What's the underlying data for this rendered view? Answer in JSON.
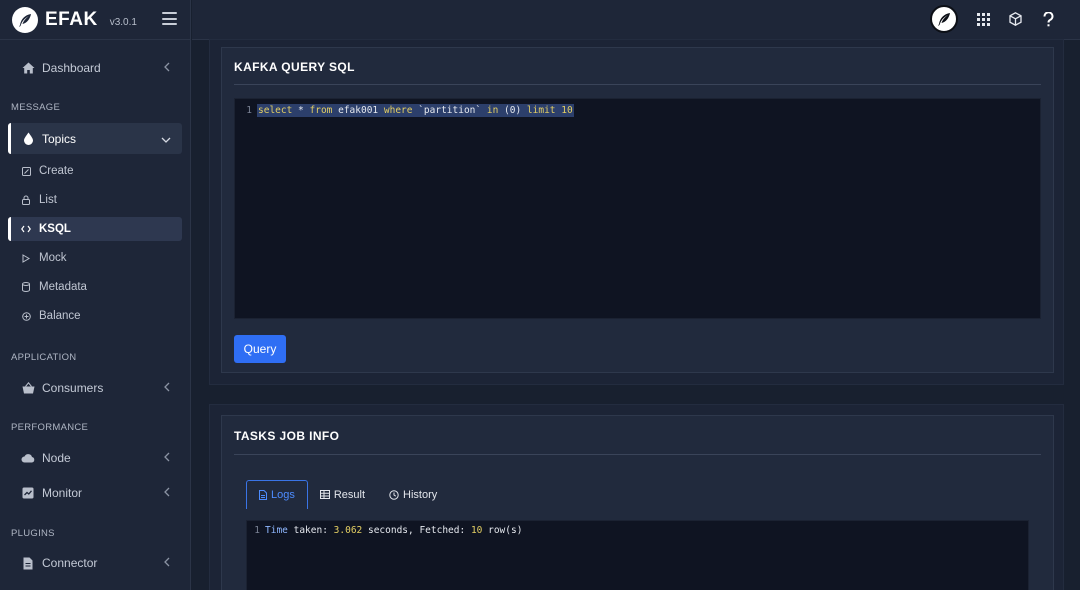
{
  "brand": {
    "name": "EFAK",
    "version": "v3.0.1"
  },
  "sidebar": {
    "dashboard": "Dashboard",
    "sections": {
      "message": "MESSAGE",
      "application": "APPLICATION",
      "performance": "PERFORMANCE",
      "plugins": "PLUGINS"
    },
    "topics": {
      "label": "Topics",
      "sub_items": [
        {
          "label": "Create",
          "icon": "edit-square-icon"
        },
        {
          "label": "List",
          "icon": "lock-icon"
        },
        {
          "label": "KSQL",
          "icon": "code-icon"
        },
        {
          "label": "Mock",
          "icon": "play-icon"
        },
        {
          "label": "Metadata",
          "icon": "database-icon"
        },
        {
          "label": "Balance",
          "icon": "balance-icon"
        }
      ]
    },
    "consumers": "Consumers",
    "node": "Node",
    "monitor": "Monitor",
    "connector": "Connector"
  },
  "query_card": {
    "title": "KAFKA QUERY SQL",
    "line_number": "1",
    "sql": {
      "t1": "select",
      "t2": " * ",
      "t3": "from",
      "t4": " efak001 ",
      "t5": "where",
      "t6": " `partition` ",
      "t7": "in",
      "t8": " (0) ",
      "t9": "limit",
      "t10": " 10"
    },
    "button": "Query"
  },
  "tasks_card": {
    "title": "TASKS JOB INFO",
    "tabs": {
      "logs": "Logs",
      "result": "Result",
      "history": "History"
    },
    "log": {
      "line_number": "1",
      "a": "Time",
      "b": " taken: ",
      "c": "3.062",
      "d": " seconds, Fetched: ",
      "e": "10",
      "f": " row(s)"
    }
  },
  "colors": {
    "accent": "#2f6ef4",
    "keyword": "#e4cf63",
    "selection": "#2c3f6b",
    "background": "#18202f"
  }
}
